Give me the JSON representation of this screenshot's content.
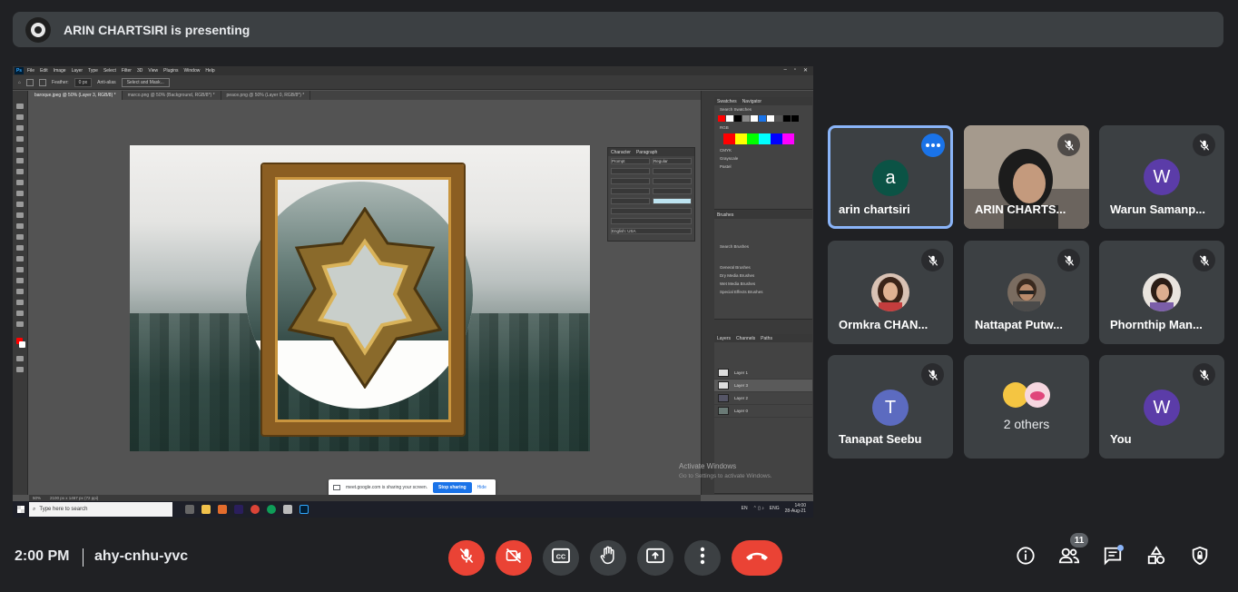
{
  "banner": {
    "text": "ARIN CHARTSIRI is presenting"
  },
  "shared_screen": {
    "menu": [
      "File",
      "Edit",
      "Image",
      "Layer",
      "Type",
      "Select",
      "Filter",
      "3D",
      "View",
      "Plugins",
      "Window",
      "Help"
    ],
    "options": {
      "feather_label": "Feather:",
      "feather_value": "0 px",
      "antialias": "Anti-alias",
      "select_mask": "Select and Mask..."
    },
    "tabs": [
      "baroque.jpeg @ 50% (Layer 3, RGB/8) *",
      "marco.png @ 50% (Background, RGB/8*) *",
      "peace.png @ 50% (Layer 0, RGB/8*) *"
    ],
    "panels": {
      "swatches_tabs": [
        "Swatches",
        "Navigator"
      ],
      "swatches_search": "Search Swatches",
      "swatch_groups": [
        "RGB",
        "CMYK",
        "Grayscale",
        "Pastel"
      ],
      "brushes_title": "Brushes",
      "brushes_search": "Search Brushes",
      "brush_groups": [
        "General Brushes",
        "Dry Media Brushes",
        "Wet Media Brushes",
        "Special Effects Brushes"
      ],
      "layers_tabs": [
        "Layers",
        "Channels",
        "Paths"
      ],
      "layers": [
        "Layer 1",
        "Layer 3",
        "Layer 2",
        "Layer 0"
      ],
      "character_tabs": [
        "Character",
        "Paragraph"
      ],
      "character_font": "Prompt",
      "character_style": "Regular",
      "character_language": "English: USA"
    },
    "status": {
      "zoom": "50%",
      "doc": "2100 px x 1467 px (72 ppi)"
    },
    "watermark": {
      "line1": "Activate Windows",
      "line2": "Go to Settings to activate Windows."
    },
    "share_notice": {
      "text": "meet.google.com is sharing your screen.",
      "stop": "Stop sharing",
      "hide": "Hide"
    },
    "taskbar": {
      "search": "Type here to search",
      "lang1": "EN",
      "lang2": "ENG",
      "time": "14:00",
      "date": "28-Aug-21"
    }
  },
  "participants": [
    {
      "name": "arin chartsiri",
      "initial": "a",
      "color": "#0b5345",
      "active": true
    },
    {
      "name": "ARIN CHARTS...",
      "video": true
    },
    {
      "name": "Warun Samanp...",
      "initial": "W",
      "color": "#5b3ca8"
    },
    {
      "name": "Ormkra CHAN...",
      "photo": true
    },
    {
      "name": "Nattapat Putw...",
      "photo": true
    },
    {
      "name": "Phornthip Man...",
      "photo": true
    },
    {
      "name": "Tanapat Seebu",
      "initial": "T",
      "color": "#5c6bc0"
    },
    {
      "others": "2 others"
    },
    {
      "name": "You",
      "initial": "W",
      "color": "#5b3ca8"
    }
  ],
  "meeting": {
    "time": "2:00 PM",
    "code": "ahy-cnhu-yvc",
    "participant_count": "11"
  },
  "controls": [
    "mic-off",
    "camera-off",
    "captions",
    "raise-hand",
    "present",
    "more-options",
    "leave-call"
  ],
  "colors": {
    "background": "#202124",
    "tile": "#3c4043",
    "danger": "#ea4335",
    "accent": "#8ab4f8",
    "blue": "#1a73e8"
  }
}
